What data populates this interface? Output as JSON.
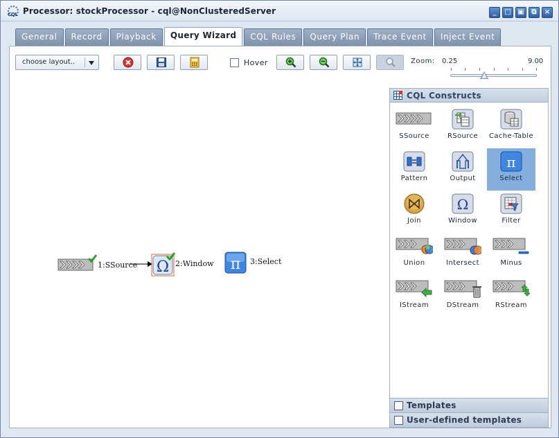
{
  "window": {
    "title": "Processor: stockProcessor - cql@NonClusteredServer",
    "app_icon_text": "CQL"
  },
  "tabs": [
    {
      "label": "General"
    },
    {
      "label": "Record"
    },
    {
      "label": "Playback"
    },
    {
      "label": "Query Wizard",
      "active": true
    },
    {
      "label": "CQL Rules"
    },
    {
      "label": "Query Plan"
    },
    {
      "label": "Trace Event"
    },
    {
      "label": "Inject Event"
    }
  ],
  "toolbar": {
    "layout_select": {
      "value": "choose layout..",
      "icon": "chevron-down-icon"
    },
    "delete_icon": "delete-icon",
    "save_icon": "save-icon",
    "generate_icon": "calculator-icon",
    "hover_label": "Hover",
    "hover_checked": false,
    "zoom_in_icon": "zoom-in-icon",
    "zoom_out_icon": "zoom-out-icon",
    "fit_icon": "fit-icon",
    "magnifier_icon": "magnifier-icon",
    "zoom_label": "Zoom:",
    "zoom_min": "0.25",
    "zoom_max": "9.00",
    "zoom_value_fraction": 0.4
  },
  "canvas": {
    "nodes": [
      {
        "label": "1:SSource",
        "icon": "stream-source-icon",
        "validated": true
      },
      {
        "label": "2:Window",
        "icon": "window-omega-icon",
        "validated": true,
        "selected": true
      },
      {
        "label": "3:Select",
        "icon": "select-pi-icon",
        "validated": false
      }
    ]
  },
  "palette": {
    "title": "CQL Constructs",
    "items": [
      {
        "label": "SSource",
        "icon": "stream-source-icon"
      },
      {
        "label": "RSource",
        "icon": "relation-source-icon"
      },
      {
        "label": "Cache-Table",
        "icon": "cache-table-icon"
      },
      {
        "label": "Pattern",
        "icon": "pattern-icon"
      },
      {
        "label": "Output",
        "icon": "output-icon"
      },
      {
        "label": "Select",
        "icon": "select-pi-icon",
        "selected": true
      },
      {
        "label": "Join",
        "icon": "join-icon"
      },
      {
        "label": "Window",
        "icon": "window-omega-icon"
      },
      {
        "label": "Filter",
        "icon": "filter-icon"
      },
      {
        "label": "Union",
        "icon": "union-icon"
      },
      {
        "label": "Intersect",
        "icon": "intersect-icon"
      },
      {
        "label": "Minus",
        "icon": "minus-icon"
      },
      {
        "label": "IStream",
        "icon": "istream-icon"
      },
      {
        "label": "DStream",
        "icon": "dstream-icon"
      },
      {
        "label": "RStream",
        "icon": "rstream-icon"
      }
    ],
    "sections": [
      {
        "label": "Templates"
      },
      {
        "label": "User-defined templates"
      }
    ]
  },
  "colors": {
    "accent": "#84aede",
    "tab_inactive": "#8a9db5",
    "window_bg": "#dfe7f1"
  }
}
